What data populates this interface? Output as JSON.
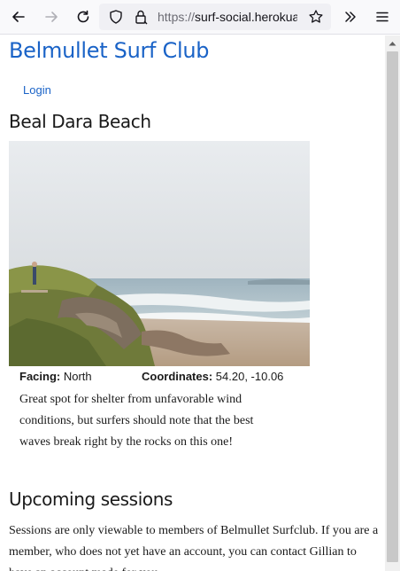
{
  "browser": {
    "url_scheme": "https://",
    "url_host": "surf-social.herokuapp.com"
  },
  "site": {
    "title": "Belmullet Surf Club",
    "login_label": "Login"
  },
  "beach": {
    "name": "Beal Dara Beach",
    "facing_label": "Facing:",
    "facing_value": "North",
    "coordinates_label": "Coordinates:",
    "coordinates_value": "54.20, -10.06",
    "description": "Great spot for shelter from unfavorable wind conditions, but surfers should note that the best waves break right by the rocks on this one!"
  },
  "sessions": {
    "heading": "Upcoming sessions",
    "notice": "Sessions are only viewable to members of Belmullet Surfclub. If you are a member, who does not yet have an account, you can contact Gillian to have an account made for you."
  },
  "icons": {
    "back": "back-arrow-icon",
    "forward": "forward-arrow-icon",
    "reload": "reload-icon",
    "shield": "tracking-shield-icon",
    "lock": "lock-icon",
    "bookmark": "bookmark-star-icon",
    "overflow": "chevron-overflow-icon",
    "menu": "hamburger-menu-icon"
  },
  "colors": {
    "link": "#1a63c7",
    "toolbar_bg": "#f9f9fb",
    "urlbar_bg": "#f0f0f4"
  }
}
